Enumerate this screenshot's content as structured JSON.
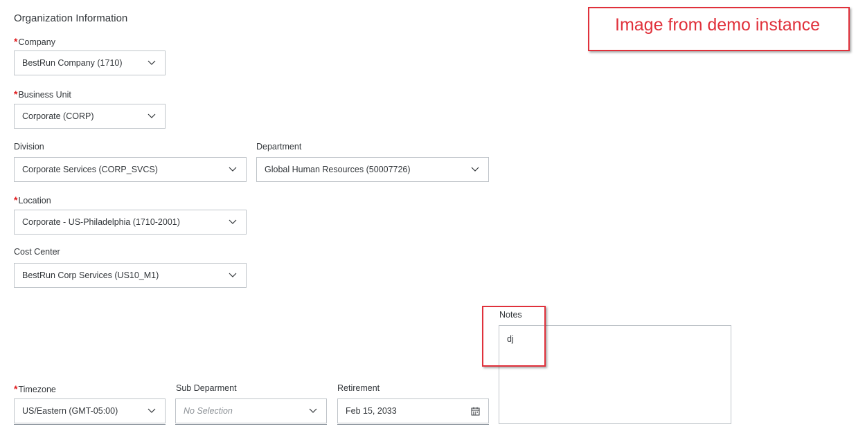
{
  "section_title": "Organization Information",
  "banner": {
    "text": "Image from demo instance"
  },
  "colors": {
    "required": "#e0191c",
    "annotation": "#e0313b",
    "border": "#bfc4c9"
  },
  "fields": {
    "company": {
      "label": "Company",
      "required": true,
      "value": "BestRun Company (1710)",
      "icon": "chevron-down-icon"
    },
    "business_unit": {
      "label": "Business Unit",
      "required": true,
      "value": "Corporate (CORP)",
      "icon": "chevron-down-icon"
    },
    "division": {
      "label": "Division",
      "required": false,
      "value": "Corporate Services (CORP_SVCS)",
      "icon": "chevron-down-icon"
    },
    "department": {
      "label": "Department",
      "required": false,
      "value": "Global Human Resources (50007726)",
      "icon": "chevron-down-icon"
    },
    "location": {
      "label": "Location",
      "required": true,
      "value": "Corporate - US-Philadelphia (1710-2001)",
      "icon": "chevron-down-icon"
    },
    "cost_center": {
      "label": "Cost Center",
      "required": false,
      "value": "BestRun Corp Services (US10_M1)",
      "icon": "chevron-down-icon"
    },
    "notes": {
      "label": "Notes",
      "value": "dj"
    },
    "timezone": {
      "label": "Timezone",
      "required": true,
      "value": "US/Eastern (GMT-05:00)",
      "icon": "chevron-down-icon"
    },
    "sub_department": {
      "label": "Sub Deparment",
      "required": false,
      "placeholder": "No Selection",
      "icon": "chevron-down-icon"
    },
    "retirement": {
      "label": "Retirement",
      "required": false,
      "value": "Feb 15, 2033",
      "icon": "calendar-icon"
    }
  }
}
